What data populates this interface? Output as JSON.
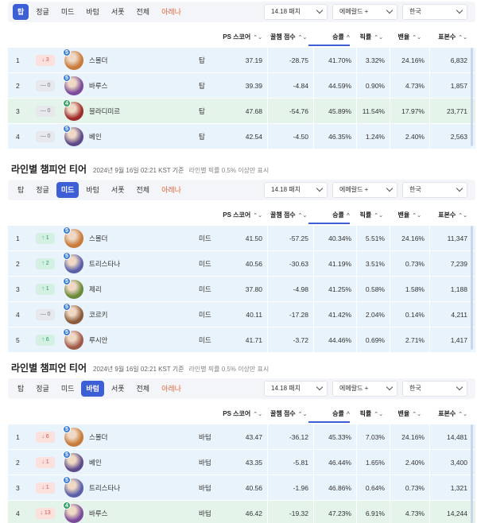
{
  "labels": {
    "table_title": "라인별 챔피언 티어",
    "timestamp": "2024년 9월 16일 02:21 KST 기준",
    "note": "라인별 픽률 0.5% 이상만 표시"
  },
  "tabs": [
    "탑",
    "정글",
    "미드",
    "바텀",
    "서폿",
    "전체",
    "아레나"
  ],
  "filters": {
    "patch": "14.18 패치",
    "rank": "에메랄드 +",
    "region": "한국"
  },
  "columns": [
    "PS 스코어",
    "꿀챔 점수",
    "승률",
    "픽률",
    "밴율",
    "표본수"
  ],
  "sort_icons": {
    "default": "⌃⌄",
    "active": "^"
  },
  "colors": {
    "active_tab": "#3d5fd6",
    "arena": "#e8663d",
    "row_bg": "#e9f3fb",
    "row_green": "#e4f4ea",
    "up": "#1f9a64",
    "down": "#d9534f"
  },
  "sections": [
    {
      "active_tab": 0,
      "show_title": false,
      "rows": [
        {
          "rank": "1",
          "change": "↓ 3",
          "dir": "down",
          "tier": "5",
          "champ": "스몰더",
          "lane": "탑",
          "ps": "37.19",
          "honey": "-28.75",
          "win": "41.70%",
          "pick": "3.32%",
          "ban": "24.16%",
          "n": "6,832",
          "color": "#c87a3a",
          "green": false
        },
        {
          "rank": "2",
          "change": "— 0",
          "dir": "same",
          "tier": "5",
          "champ": "바루스",
          "lane": "탑",
          "ps": "39.39",
          "honey": "-4.84",
          "win": "44.59%",
          "pick": "0.90%",
          "ban": "4.73%",
          "n": "1,857",
          "color": "#7b4a9a",
          "green": false
        },
        {
          "rank": "3",
          "change": "— 0",
          "dir": "same",
          "tier": "4",
          "champ": "블라디미르",
          "lane": "탑",
          "ps": "47.68",
          "honey": "-54.76",
          "win": "45.89%",
          "pick": "11.54%",
          "ban": "17.97%",
          "n": "23,771",
          "color": "#9e2b2b",
          "green": true
        },
        {
          "rank": "4",
          "change": "— 0",
          "dir": "same",
          "tier": "5",
          "champ": "베인",
          "lane": "탑",
          "ps": "42.54",
          "honey": "-4.50",
          "win": "46.35%",
          "pick": "1.24%",
          "ban": "2.40%",
          "n": "2,563",
          "color": "#5c4a8a",
          "green": false
        }
      ]
    },
    {
      "active_tab": 2,
      "show_title": true,
      "rows": [
        {
          "rank": "1",
          "change": "↑ 1",
          "dir": "up",
          "tier": "5",
          "champ": "스몰더",
          "lane": "미드",
          "ps": "41.50",
          "honey": "-57.25",
          "win": "40.34%",
          "pick": "5.51%",
          "ban": "24.16%",
          "n": "11,347",
          "color": "#c87a3a",
          "green": false
        },
        {
          "rank": "2",
          "change": "↑ 2",
          "dir": "up",
          "tier": "5",
          "champ": "트리스타나",
          "lane": "미드",
          "ps": "40.56",
          "honey": "-30.63",
          "win": "41.19%",
          "pick": "3.51%",
          "ban": "0.73%",
          "n": "7,239",
          "color": "#5a5fa8",
          "green": false
        },
        {
          "rank": "3",
          "change": "↑ 1",
          "dir": "up",
          "tier": "5",
          "champ": "제리",
          "lane": "미드",
          "ps": "37.80",
          "honey": "-4.98",
          "win": "41.25%",
          "pick": "0.58%",
          "ban": "1.58%",
          "n": "1,188",
          "color": "#6a8a3a",
          "green": false
        },
        {
          "rank": "4",
          "change": "— 0",
          "dir": "same",
          "tier": "5",
          "champ": "코르키",
          "lane": "미드",
          "ps": "40.11",
          "honey": "-17.28",
          "win": "41.42%",
          "pick": "2.04%",
          "ban": "0.14%",
          "n": "4,211",
          "color": "#8a5a3a",
          "green": false
        },
        {
          "rank": "5",
          "change": "↑ 6",
          "dir": "up",
          "tier": "5",
          "champ": "루시안",
          "lane": "미드",
          "ps": "41.71",
          "honey": "-3.72",
          "win": "44.46%",
          "pick": "0.69%",
          "ban": "2.71%",
          "n": "1,417",
          "color": "#a05a4a",
          "green": false
        }
      ]
    },
    {
      "active_tab": 3,
      "show_title": true,
      "rows": [
        {
          "rank": "1",
          "change": "↓ 6",
          "dir": "down",
          "tier": "5",
          "champ": "스몰더",
          "lane": "바텀",
          "ps": "43.47",
          "honey": "-36.12",
          "win": "45.33%",
          "pick": "7.03%",
          "ban": "24.16%",
          "n": "14,481",
          "color": "#c87a3a",
          "green": false
        },
        {
          "rank": "2",
          "change": "↓ 1",
          "dir": "down",
          "tier": "5",
          "champ": "베인",
          "lane": "바텀",
          "ps": "43.35",
          "honey": "-5.81",
          "win": "46.44%",
          "pick": "1.65%",
          "ban": "2.40%",
          "n": "3,400",
          "color": "#5c4a8a",
          "green": false
        },
        {
          "rank": "3",
          "change": "↓ 1",
          "dir": "down",
          "tier": "5",
          "champ": "트리스타나",
          "lane": "바텀",
          "ps": "40.56",
          "honey": "-1.96",
          "win": "46.86%",
          "pick": "0.64%",
          "ban": "0.73%",
          "n": "1,321",
          "color": "#5a5fa8",
          "green": false
        },
        {
          "rank": "4",
          "change": "↓ 13",
          "dir": "down",
          "tier": "4",
          "champ": "바루스",
          "lane": "바텀",
          "ps": "46.42",
          "honey": "-19.32",
          "win": "47.23%",
          "pick": "6.91%",
          "ban": "4.73%",
          "n": "14,244",
          "color": "#7b4a9a",
          "green": true
        }
      ]
    }
  ]
}
